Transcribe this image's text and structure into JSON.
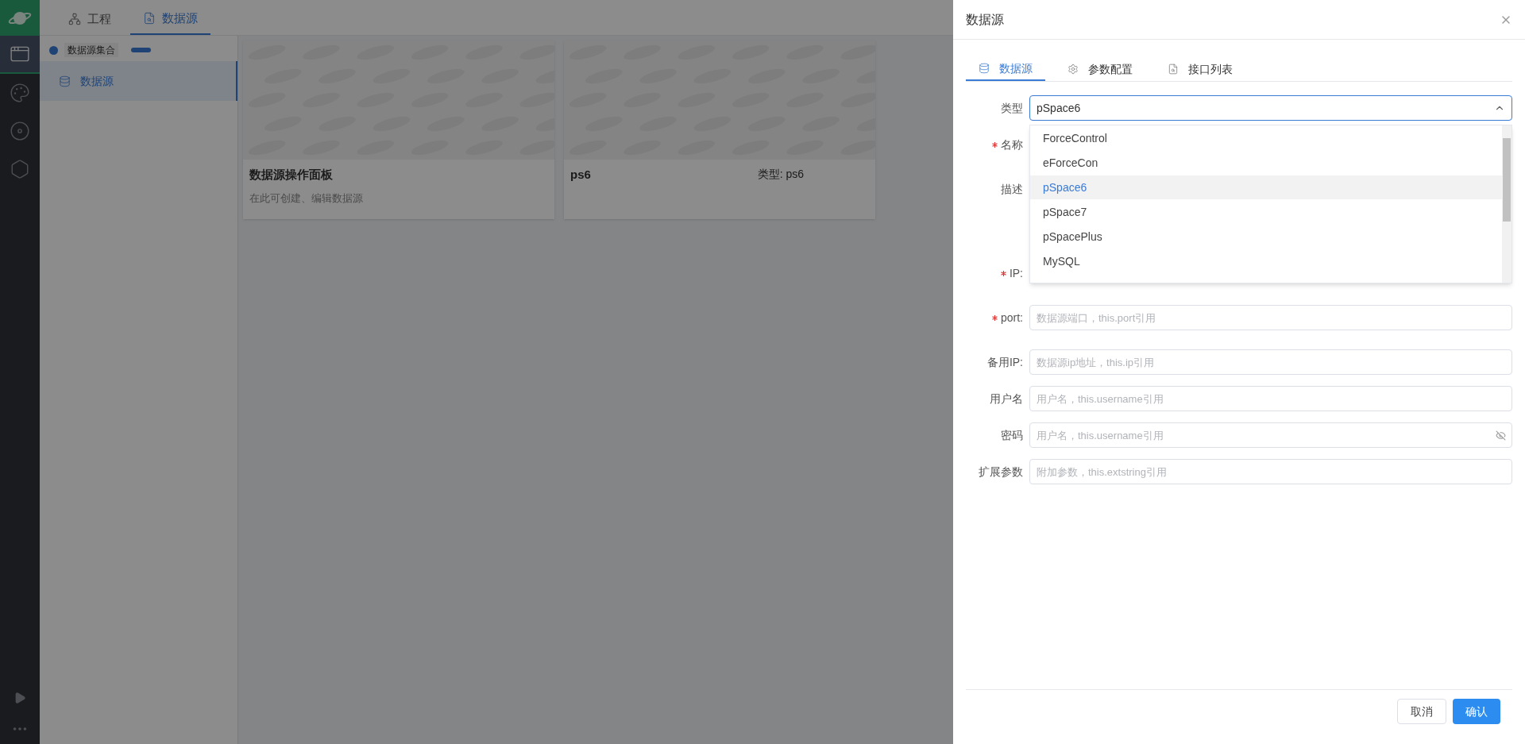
{
  "rail": {
    "items": [
      {
        "selected": true
      },
      {
        "selected": false
      },
      {
        "selected": false
      },
      {
        "selected": false
      }
    ]
  },
  "top_tabs": [
    {
      "label": "工程",
      "selected": false
    },
    {
      "label": "数据源",
      "selected": true
    }
  ],
  "sidebar": {
    "group": "数据源集合",
    "items": [
      {
        "label": "数据源",
        "selected": true
      }
    ]
  },
  "cards": [
    {
      "title": "数据源操作面板",
      "subtitle": "在此可创建、编辑数据源"
    },
    {
      "title": "ps6",
      "type": "类型: ps6"
    }
  ],
  "drawer": {
    "title": "数据源",
    "tabs": [
      {
        "label": "数据源",
        "selected": true
      },
      {
        "label": "参数配置",
        "selected": false
      },
      {
        "label": "接口列表",
        "selected": false
      }
    ],
    "fields": [
      {
        "kind": "select",
        "label": "类型",
        "required": false,
        "value": "pSpace6"
      },
      {
        "kind": "covered",
        "label": "名称",
        "required": true
      },
      {
        "kind": "covered_tall",
        "label": "描述",
        "required": false
      },
      {
        "kind": "covered",
        "label": "IP:",
        "required": true
      },
      {
        "kind": "text",
        "label": "port:",
        "required": true,
        "placeholder": "数据源端口，this.port引用"
      },
      {
        "kind": "text",
        "label": "备用IP:",
        "required": false,
        "placeholder": "数据源ip地址，this.ip引用"
      },
      {
        "kind": "text",
        "label": "用户名",
        "required": false,
        "placeholder": "用户名，this.username引用"
      },
      {
        "kind": "password",
        "label": "密码",
        "required": false,
        "placeholder": "用户名，this.username引用"
      },
      {
        "kind": "text",
        "label": "扩展参数",
        "required": false,
        "placeholder": "附加参数，this.extstring引用"
      }
    ],
    "dropdown": [
      {
        "label": "ForceControl",
        "selected": false
      },
      {
        "label": "eForceCon",
        "selected": false
      },
      {
        "label": "pSpace6",
        "selected": true
      },
      {
        "label": "pSpace7",
        "selected": false
      },
      {
        "label": "pSpacePlus",
        "selected": false
      },
      {
        "label": "MySQL",
        "selected": false
      }
    ],
    "buttons": {
      "cancel": "取消",
      "ok": "确认"
    }
  }
}
